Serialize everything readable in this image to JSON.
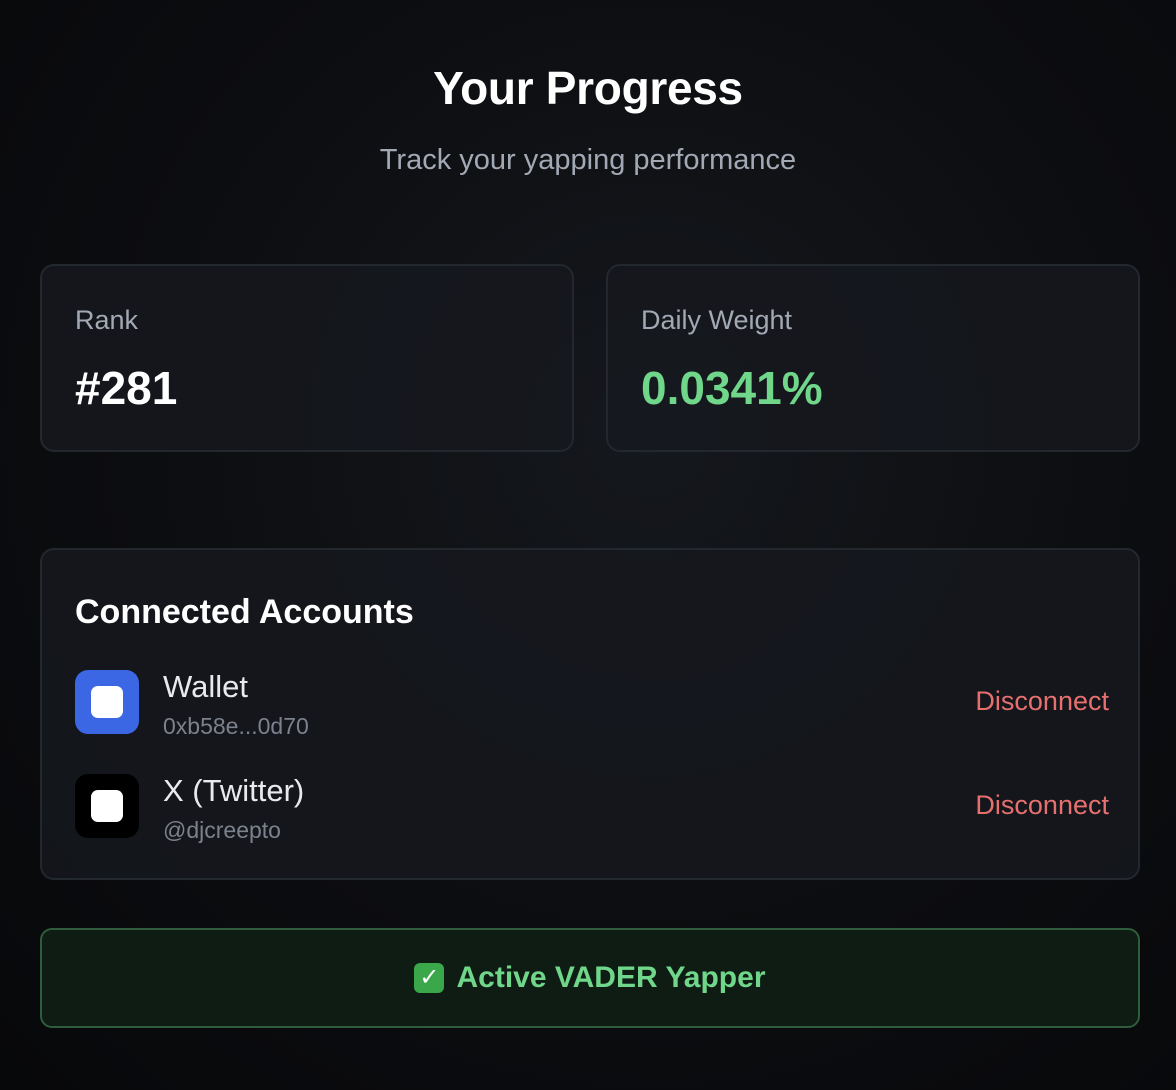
{
  "header": {
    "title": "Your Progress",
    "subtitle": "Track your yapping performance"
  },
  "stats": {
    "rank": {
      "label": "Rank",
      "value": "#281"
    },
    "daily_weight": {
      "label": "Daily Weight",
      "value": "0.0341%"
    }
  },
  "connected_accounts": {
    "title": "Connected Accounts",
    "items": [
      {
        "name": "Wallet",
        "handle": "0xb58e...0d70",
        "action": "Disconnect",
        "icon": "wallet-icon"
      },
      {
        "name": "X (Twitter)",
        "handle": "@djcreepto",
        "action": "Disconnect",
        "icon": "x-icon"
      }
    ]
  },
  "status": {
    "icon": "check-mark-icon",
    "text": "Active VADER Yapper"
  },
  "colors": {
    "accent_green": "#6fd68a",
    "disconnect_red": "#e5706e",
    "wallet_blue": "#3b67e4"
  }
}
